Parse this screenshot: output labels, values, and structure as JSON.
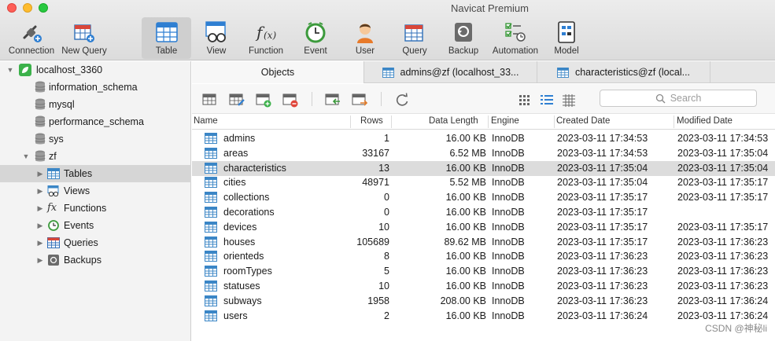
{
  "window": {
    "title": "Navicat Premium"
  },
  "toolbar": {
    "buttons": [
      {
        "label": "Connection"
      },
      {
        "label": "New Query"
      },
      {
        "label": "Table"
      },
      {
        "label": "View"
      },
      {
        "label": "Function"
      },
      {
        "label": "Event"
      },
      {
        "label": "User"
      },
      {
        "label": "Query"
      },
      {
        "label": "Backup"
      },
      {
        "label": "Automation"
      },
      {
        "label": "Model"
      }
    ]
  },
  "sidebar": {
    "connection": "localhost_3360",
    "databases": [
      "information_schema",
      "mysql",
      "performance_schema",
      "sys",
      "zf"
    ],
    "zf_children": [
      "Tables",
      "Views",
      "Functions",
      "Events",
      "Queries",
      "Backups"
    ]
  },
  "tabs": [
    {
      "label": "Objects"
    },
    {
      "label": "admins@zf (localhost_33..."
    },
    {
      "label": "characteristics@zf (local..."
    }
  ],
  "search": {
    "placeholder": "Search"
  },
  "table": {
    "columns": [
      "Name",
      "Rows",
      "Data Length",
      "Engine",
      "Created Date",
      "Modified Date"
    ],
    "rows": [
      {
        "name": "admins",
        "rows": "1",
        "length": "16.00 KB",
        "engine": "InnoDB",
        "created": "2023-03-11 17:34:53",
        "modified": "2023-03-11 17:34:53"
      },
      {
        "name": "areas",
        "rows": "33167",
        "length": "6.52 MB",
        "engine": "InnoDB",
        "created": "2023-03-11 17:34:53",
        "modified": "2023-03-11 17:35:04"
      },
      {
        "name": "characteristics",
        "rows": "13",
        "length": "16.00 KB",
        "engine": "InnoDB",
        "created": "2023-03-11 17:35:04",
        "modified": "2023-03-11 17:35:04"
      },
      {
        "name": "cities",
        "rows": "48971",
        "length": "5.52 MB",
        "engine": "InnoDB",
        "created": "2023-03-11 17:35:04",
        "modified": "2023-03-11 17:35:17"
      },
      {
        "name": "collections",
        "rows": "0",
        "length": "16.00 KB",
        "engine": "InnoDB",
        "created": "2023-03-11 17:35:17",
        "modified": "2023-03-11 17:35:17"
      },
      {
        "name": "decorations",
        "rows": "0",
        "length": "16.00 KB",
        "engine": "InnoDB",
        "created": "2023-03-11 17:35:17",
        "modified": ""
      },
      {
        "name": "devices",
        "rows": "10",
        "length": "16.00 KB",
        "engine": "InnoDB",
        "created": "2023-03-11 17:35:17",
        "modified": "2023-03-11 17:35:17"
      },
      {
        "name": "houses",
        "rows": "105689",
        "length": "89.62 MB",
        "engine": "InnoDB",
        "created": "2023-03-11 17:35:17",
        "modified": "2023-03-11 17:36:23"
      },
      {
        "name": "orienteds",
        "rows": "8",
        "length": "16.00 KB",
        "engine": "InnoDB",
        "created": "2023-03-11 17:36:23",
        "modified": "2023-03-11 17:36:23"
      },
      {
        "name": "roomTypes",
        "rows": "5",
        "length": "16.00 KB",
        "engine": "InnoDB",
        "created": "2023-03-11 17:36:23",
        "modified": "2023-03-11 17:36:23"
      },
      {
        "name": "statuses",
        "rows": "10",
        "length": "16.00 KB",
        "engine": "InnoDB",
        "created": "2023-03-11 17:36:23",
        "modified": "2023-03-11 17:36:23"
      },
      {
        "name": "subways",
        "rows": "1958",
        "length": "208.00 KB",
        "engine": "InnoDB",
        "created": "2023-03-11 17:36:23",
        "modified": "2023-03-11 17:36:24"
      },
      {
        "name": "users",
        "rows": "2",
        "length": "16.00 KB",
        "engine": "InnoDB",
        "created": "2023-03-11 17:36:24",
        "modified": "2023-03-11 17:36:24"
      }
    ]
  },
  "watermark": "CSDN @神秘li",
  "colors": {
    "table_icon": "#3b86c6",
    "selection": "#dcdcdc",
    "sidebar_bg": "#f3f3f3"
  }
}
